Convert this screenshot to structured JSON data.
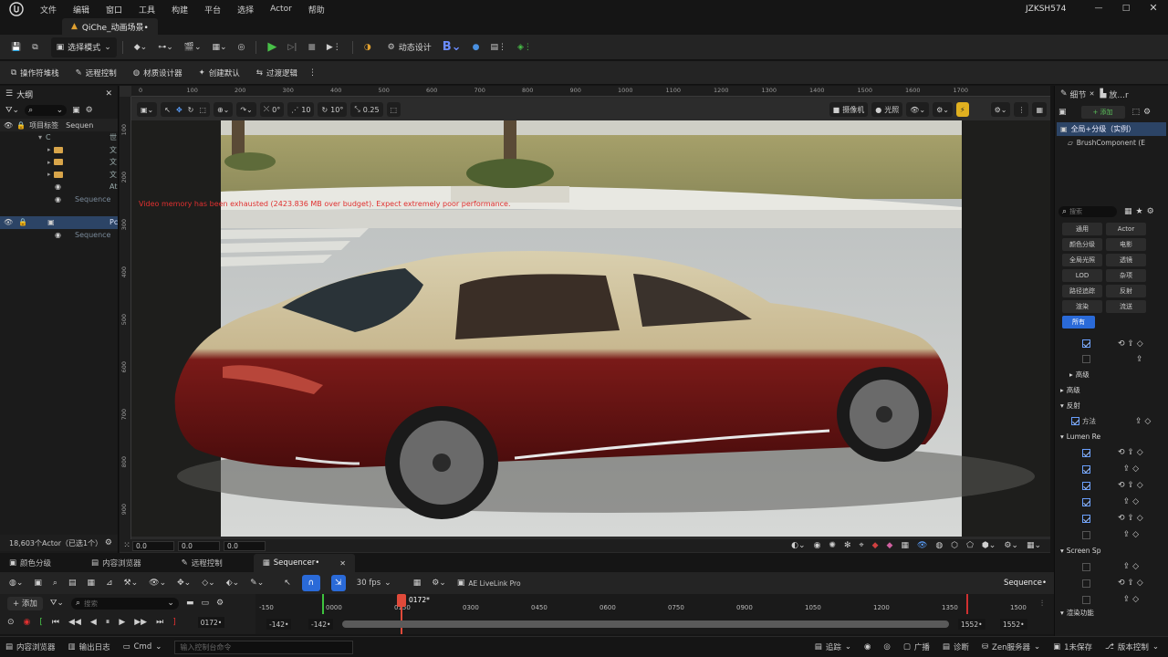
{
  "title_bar": {
    "menu": [
      "文件",
      "编辑",
      "窗口",
      "工具",
      "构建",
      "平台",
      "选择",
      "Actor",
      "帮助"
    ],
    "user": "JZKSH574",
    "tab_label": "QiChe_动画场景•"
  },
  "toolbar": {
    "mode_label": "选择模式",
    "dynamic_design": "动态设计"
  },
  "toolbar2": {
    "items": [
      "操作符堆栈",
      "远程控制",
      "材质设计器",
      "创建默认",
      "过渡逻辑"
    ]
  },
  "outliner": {
    "title": "大纲",
    "col_label": "项目标签",
    "col_type": "Sequen",
    "rows": [
      {
        "label": "C",
        "type": "世"
      },
      {
        "label": "",
        "type": "文"
      },
      {
        "label": "",
        "type": "文"
      },
      {
        "label": "",
        "type": "文"
      },
      {
        "label": "",
        "type": "At"
      },
      {
        "label": "",
        "type": "Sequence"
      },
      {
        "label": "",
        "type": "Pc"
      },
      {
        "label": "",
        "type": "Sequence"
      }
    ],
    "actor_count": "18,603个Actor（已选1个）"
  },
  "viewport": {
    "ruler_ticks": [
      "0",
      "100",
      "200",
      "300",
      "400",
      "500",
      "600",
      "700",
      "800",
      "900",
      "1000",
      "1100",
      "1200",
      "1300",
      "1400",
      "1500",
      "1600",
      "1700"
    ],
    "ruler_left": [
      "100",
      "200",
      "300",
      "400",
      "500",
      "600",
      "700",
      "800",
      "900"
    ],
    "angle": "0°",
    "grid": "10",
    "rot_snap": "10°",
    "scale_snap": "0.25",
    "camera_label": "摄像机",
    "lighting_label": "光照",
    "warning": "Video memory has been exhausted (2423.836 MB over budget). Expect extremely poor performance.",
    "coords": [
      "0.0",
      "0.0",
      "0.0"
    ]
  },
  "details": {
    "tab_details": "细节",
    "tab_other": "放...r",
    "add_label": "+ 添加",
    "component_root": "全局+分级（实例）",
    "component_child": "BrushComponent (E",
    "search_placeholder": "搜索",
    "filter_chips": [
      "通用",
      "Actor",
      "颜色分级",
      "电影",
      "全局光照",
      "透镜",
      "LOD",
      "杂项",
      "路径追踪",
      "反射",
      "渲染",
      "流送",
      "所有"
    ],
    "sections": [
      "高级",
      "高级",
      "反射",
      "方法",
      "Lumen Re",
      "Screen Sp",
      "渲染功能"
    ]
  },
  "bottom_tabs": [
    "颜色分级",
    "内容浏览器",
    "远程控制",
    "Sequencer•"
  ],
  "sequencer": {
    "fps": "30 fps",
    "livelink": "AE LiveLink Pro",
    "seq_name": "Sequence•",
    "add_label": "+ 添加",
    "search_placeholder": "搜索",
    "current_frame": "0172•",
    "playhead_label": "0172*",
    "timeline_labels": [
      "-150",
      "0000",
      "0150",
      "0300",
      "0450",
      "0600",
      "0750",
      "0900",
      "1050",
      "1200",
      "1350",
      "1500"
    ],
    "range_left_a": "-142•",
    "range_left_b": "-142•",
    "range_right_a": "1552•",
    "range_right_b": "1552•"
  },
  "status_bar": {
    "content_drawer": "内容浏览器",
    "output_log": "输出日志",
    "cmd": "Cmd",
    "cmd_placeholder": "输入控制台命令",
    "trace": "追踪",
    "broadcast": "广播",
    "diagnose": "诊断",
    "zen": "Zen服务器",
    "unsaved": "1未保存",
    "version": "版本控制"
  }
}
